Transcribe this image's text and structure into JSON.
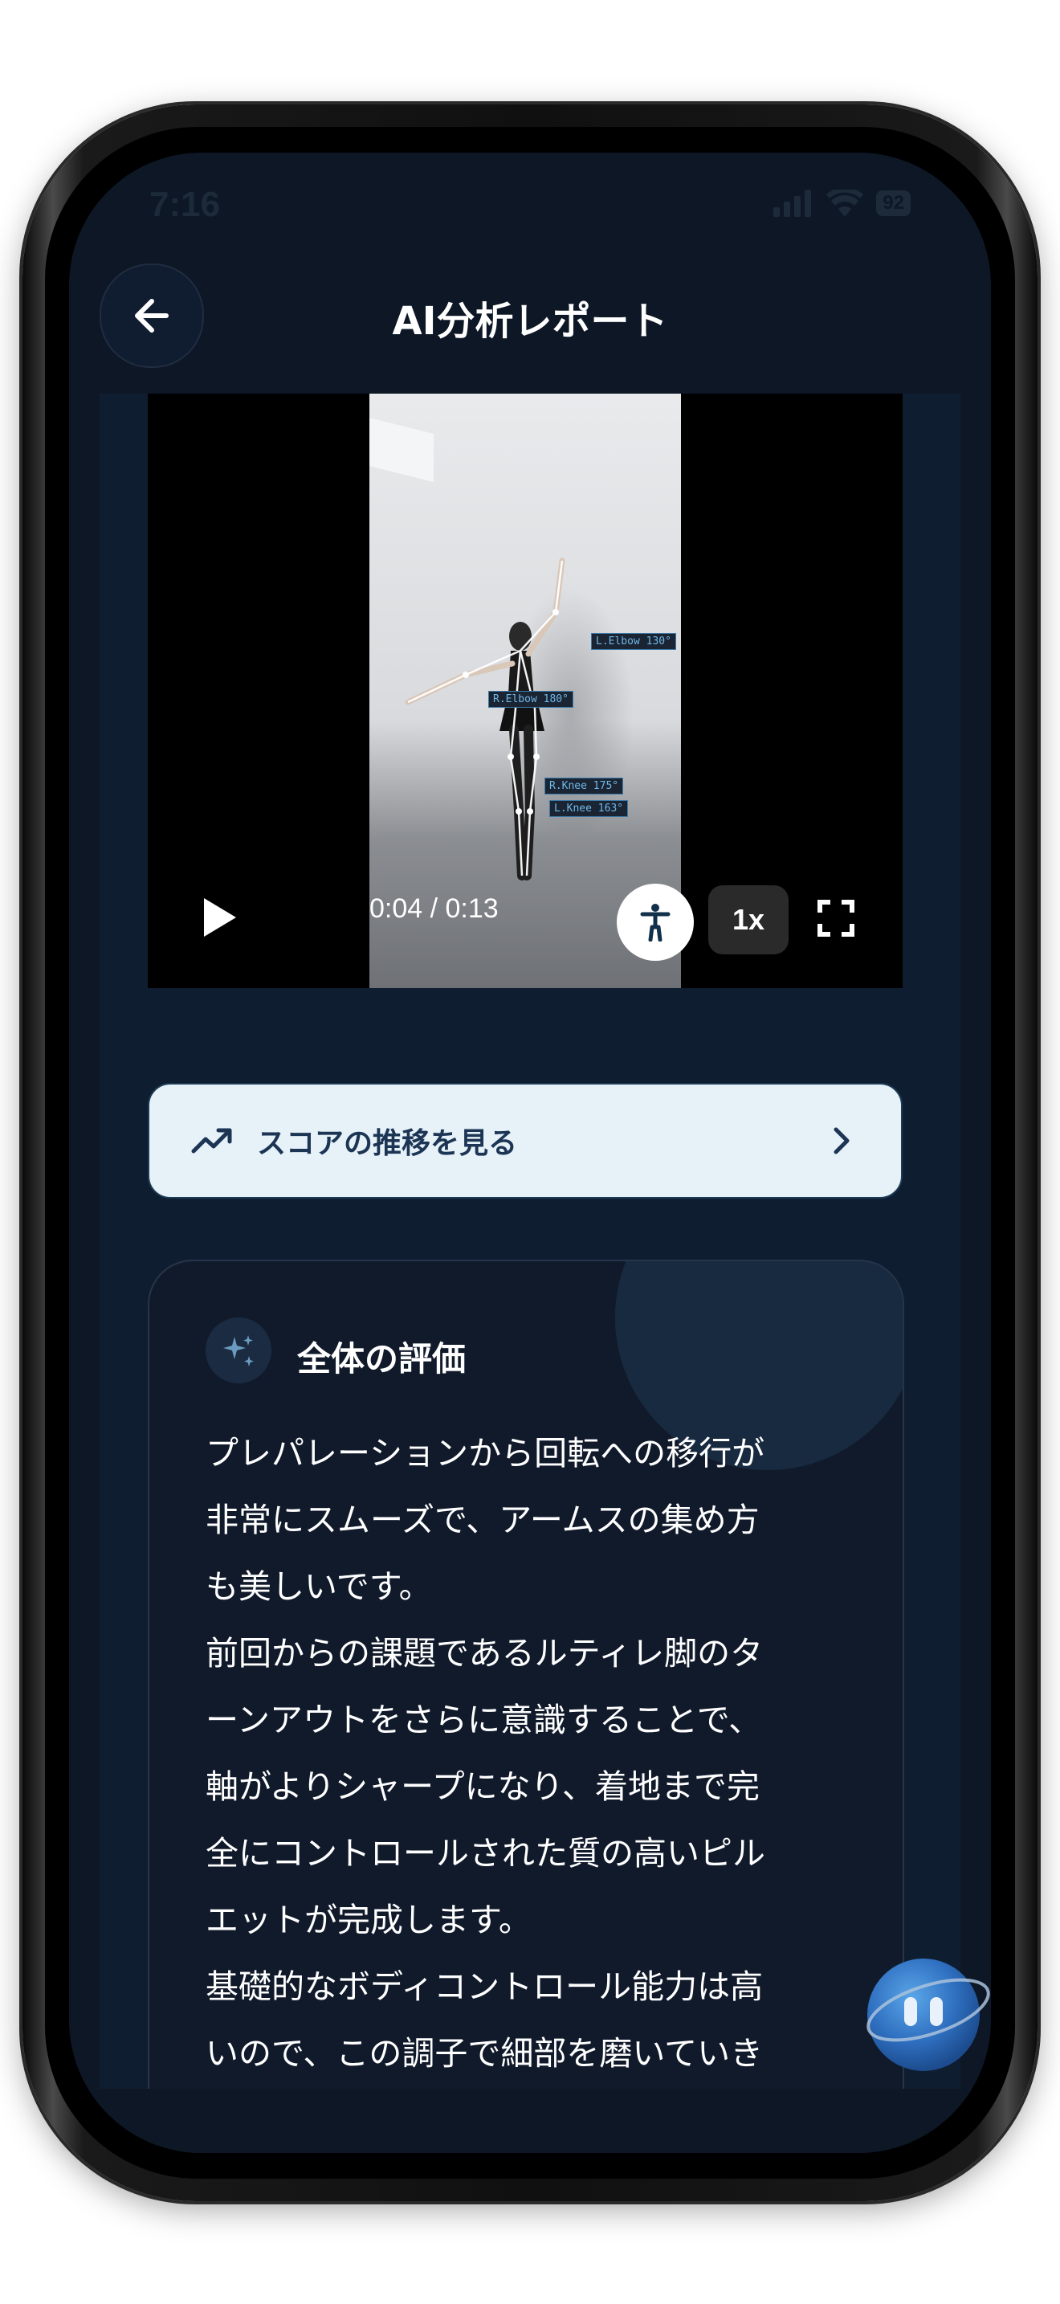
{
  "status_bar": {
    "time": "7:16",
    "battery": "92"
  },
  "header": {
    "title": "AI分析レポート"
  },
  "video": {
    "time_display": "0:04 / 0:13",
    "speed": "1x",
    "pose_labels": {
      "l_elbow": "L.Elbow 130°",
      "r_elbow": "R.Elbow 180°",
      "r_knee": "R.Knee 175°",
      "l_knee": "L.Knee 163°"
    }
  },
  "score_trend_button": {
    "label": "スコアの推移を見る"
  },
  "evaluation": {
    "title": "全体の評価",
    "body": "プレパレーションから回転への移行が\n非常にスムーズで、アームスの集め方\nも美しいです。\n前回からの課題であるルティレ脚のタ\nーンアウトをさらに意識することで、\n軸がよりシャープになり、着地まで完\n全にコントロールされた質の高いピル\nエットが完成します。\n基礎的なボディコントロール能力は高\nいので、この調子で細部を磨いていき"
  },
  "colors": {
    "screen_bg": "#0d1726",
    "content_bg": "#0f1d31",
    "card_bg": "#111a2b",
    "score_btn_bg": "#e6f1f8",
    "accent_label": "#6fb8e8"
  },
  "icons": [
    "back-arrow-icon",
    "play-icon",
    "pose-figure-icon",
    "fullscreen-icon",
    "trend-up-icon",
    "chevron-right-icon",
    "sparkles-icon",
    "ai-assistant-icon",
    "signal-icon",
    "wifi-icon"
  ]
}
